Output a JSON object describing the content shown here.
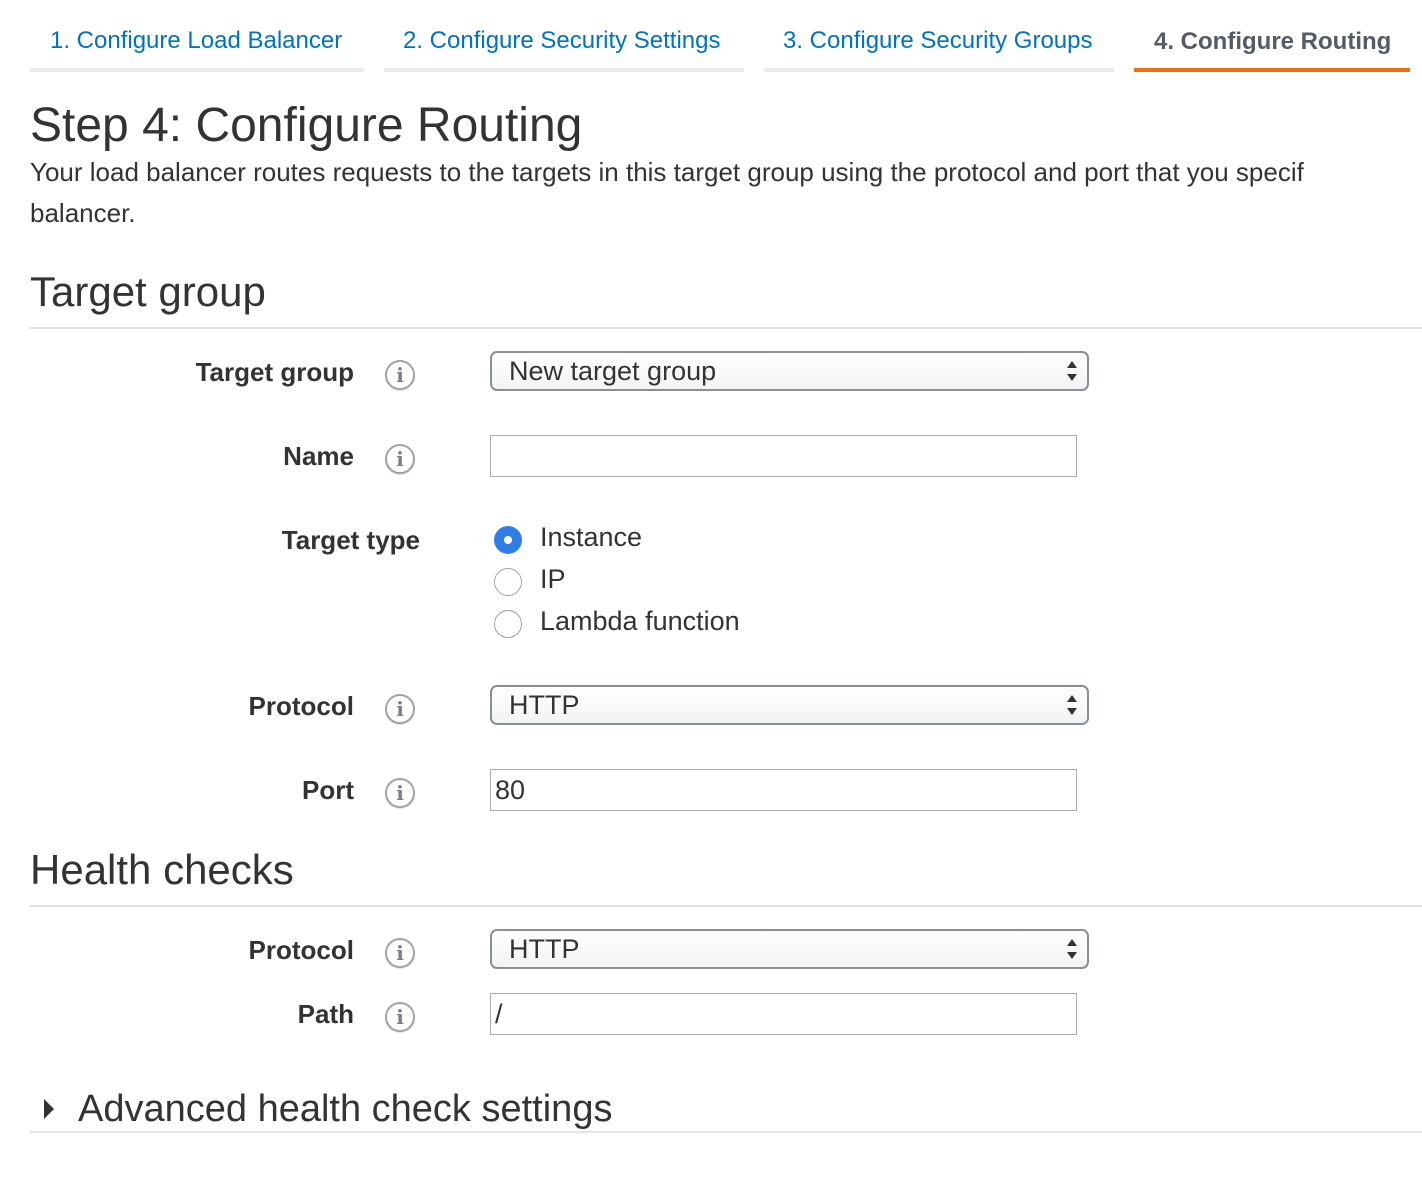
{
  "tabs": [
    {
      "label": "1. Configure Load Balancer"
    },
    {
      "label": "2. Configure Security Settings"
    },
    {
      "label": "3. Configure Security Groups"
    },
    {
      "label": "4. Configure Routing",
      "active": true
    }
  ],
  "page": {
    "title": "Step 4: Configure Routing",
    "description_line1": "Your load balancer routes requests to the targets in this target group using the protocol and port that you specif",
    "description_line2": "balancer."
  },
  "target_group_section": {
    "heading": "Target group",
    "target_group_label": "Target group",
    "target_group_value": "New target group",
    "name_label": "Name",
    "name_value": "",
    "target_type_label": "Target type",
    "target_type_options": [
      {
        "label": "Instance",
        "checked": true
      },
      {
        "label": "IP",
        "checked": false
      },
      {
        "label": "Lambda function",
        "checked": false
      }
    ],
    "protocol_label": "Protocol",
    "protocol_value": "HTTP",
    "port_label": "Port",
    "port_value": "80"
  },
  "health_checks_section": {
    "heading": "Health checks",
    "protocol_label": "Protocol",
    "protocol_value": "HTTP",
    "path_label": "Path",
    "path_value": "/"
  },
  "advanced": {
    "label": "Advanced health check settings"
  },
  "icons": {
    "info": "info-icon",
    "select_arrows": "select-arrows-icon",
    "expand": "triangle-right-icon"
  },
  "colors": {
    "link_blue": "#0073bb",
    "active_tab_accent": "#ec7211",
    "radio_checked": "#2f7ee8"
  }
}
